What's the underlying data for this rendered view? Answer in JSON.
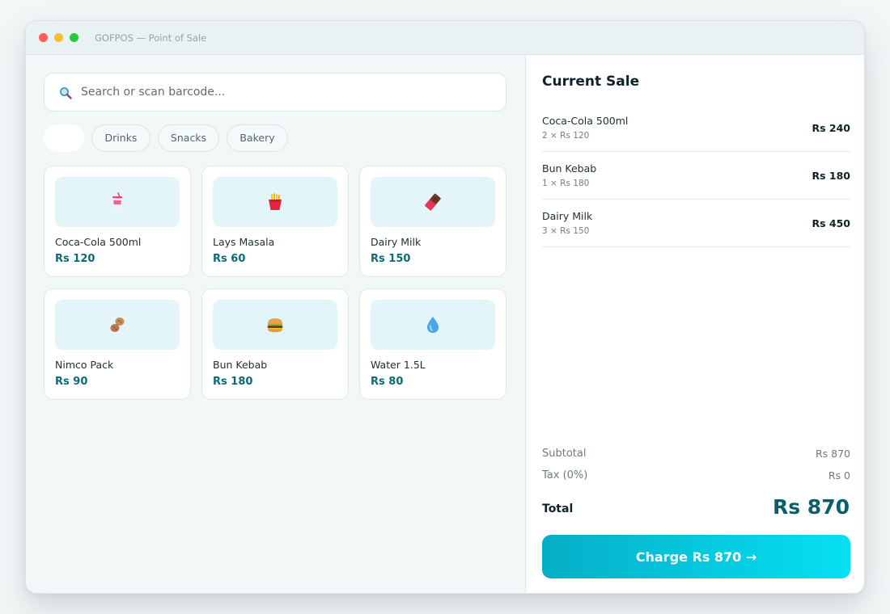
{
  "window": {
    "title": "GOFPOS — Point of Sale"
  },
  "search": {
    "placeholder": "Search or scan barcode..."
  },
  "categories": [
    {
      "label": "",
      "active": true
    },
    {
      "label": "Drinks",
      "active": false
    },
    {
      "label": "Snacks",
      "active": false
    },
    {
      "label": "Bakery",
      "active": false
    }
  ],
  "products": [
    {
      "name": "Coca-Cola 500ml",
      "price": "Rs 120",
      "icon": "soda-cup-icon"
    },
    {
      "name": "Lays Masala",
      "price": "Rs 60",
      "icon": "fries-icon"
    },
    {
      "name": "Dairy Milk",
      "price": "Rs 150",
      "icon": "chocolate-bar-icon"
    },
    {
      "name": "Nimco Pack",
      "price": "Rs 90",
      "icon": "peanuts-icon"
    },
    {
      "name": "Bun Kebab",
      "price": "Rs 180",
      "icon": "burger-icon"
    },
    {
      "name": "Water 1.5L",
      "price": "Rs 80",
      "icon": "water-drop-icon"
    }
  ],
  "sale": {
    "title": "Current Sale",
    "items": [
      {
        "name": "Coca-Cola 500ml",
        "qty": "2 × Rs 120",
        "total": "Rs 240"
      },
      {
        "name": "Bun Kebab",
        "qty": "1 × Rs 180",
        "total": "Rs 180"
      },
      {
        "name": "Dairy Milk",
        "qty": "3 × Rs 150",
        "total": "Rs 450"
      }
    ],
    "subtotal_label": "Subtotal",
    "subtotal": "Rs 870",
    "tax_label": "Tax (0%)",
    "tax": "Rs 0",
    "total_label": "Total",
    "total": "Rs 870",
    "charge_label": "Charge Rs 870 →"
  },
  "colors": {
    "accent": "#05c3dc",
    "price": "#0c6a76",
    "total": "#0a5f6a"
  }
}
